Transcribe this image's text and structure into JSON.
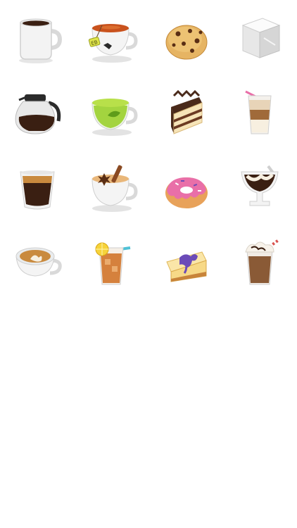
{
  "stickers": [
    {
      "name": "coffee-mug-sticker"
    },
    {
      "name": "black-tea-cup-sticker",
      "tag_text": "EB"
    },
    {
      "name": "chocolate-chip-cookie-sticker"
    },
    {
      "name": "sugar-cube-sticker"
    },
    {
      "name": "coffee-pot-sticker"
    },
    {
      "name": "green-tea-cup-sticker"
    },
    {
      "name": "layer-cake-slice-sticker"
    },
    {
      "name": "iced-latte-glass-sticker"
    },
    {
      "name": "espresso-glass-sticker"
    },
    {
      "name": "chai-spice-cup-sticker"
    },
    {
      "name": "pink-donut-sticker"
    },
    {
      "name": "sundae-glass-sticker"
    },
    {
      "name": "latte-art-cup-sticker"
    },
    {
      "name": "iced-tea-lemon-sticker"
    },
    {
      "name": "blueberry-cheesecake-sticker"
    },
    {
      "name": "iced-mocha-straw-sticker"
    }
  ],
  "colors": {
    "coffee": "#3a1f12",
    "cup": "#f2f2f2",
    "tea": "#c9521d",
    "green_tea": "#9ad02c",
    "crema": "#c98a3e",
    "pink": "#e96fa8",
    "lemon": "#f6d33b",
    "blueberry": "#6b4bb8"
  }
}
